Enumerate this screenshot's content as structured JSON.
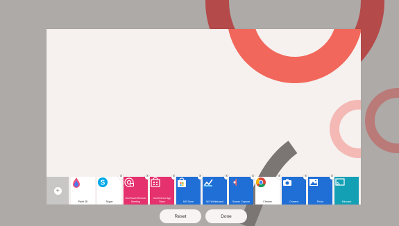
{
  "add_tile": {
    "symbol": "+"
  },
  "apps": [
    {
      "label": "Paint 3D",
      "bg": "#ffffff",
      "text": "#222222",
      "icon": "paint3d-icon",
      "closable": false
    },
    {
      "label": "Skype",
      "bg": "#ffffff",
      "text": "#222222",
      "icon": "skype-icon",
      "closable": true
    },
    {
      "label": "OneTouch Remote Meeting",
      "bg": "#e5316e",
      "text": "#ffffff",
      "icon": "remote-meeting-icon",
      "closable": true
    },
    {
      "label": "Conference App Store",
      "bg": "#e5316e",
      "text": "#ffffff",
      "icon": "app-store-icon",
      "closable": true
    },
    {
      "label": "MS Store",
      "bg": "#1f6fd6",
      "text": "#ffffff",
      "icon": "ms-store-icon",
      "closable": true
    },
    {
      "label": "MS Whiteboard",
      "bg": "#1f6fd6",
      "text": "#ffffff",
      "icon": "whiteboard-icon",
      "closable": true
    },
    {
      "label": "Screen Capture",
      "bg": "#1f6fd6",
      "text": "#ffffff",
      "icon": "screen-capture-icon",
      "closable": true
    },
    {
      "label": "Chrome",
      "bg": "#ffffff",
      "text": "#222222",
      "icon": "chrome-icon",
      "closable": true
    },
    {
      "label": "Camera",
      "bg": "#1f6fd6",
      "text": "#ffffff",
      "icon": "camera-icon",
      "closable": true
    },
    {
      "label": "Photo",
      "bg": "#1f6fd6",
      "text": "#ffffff",
      "icon": "photo-icon",
      "closable": true
    },
    {
      "label": "Miracast",
      "bg": "#13a0b5",
      "text": "#ffffff",
      "icon": "miracast-icon",
      "closable": false
    }
  ],
  "close_symbol": "×",
  "buttons": {
    "reset": "Reset",
    "done": "Done"
  },
  "colors": {
    "accent_coral": "#f2675b",
    "outer_arc": "#b54a4a",
    "pink_ring": "#f4b9b5",
    "bg": "#aeaaa8"
  }
}
